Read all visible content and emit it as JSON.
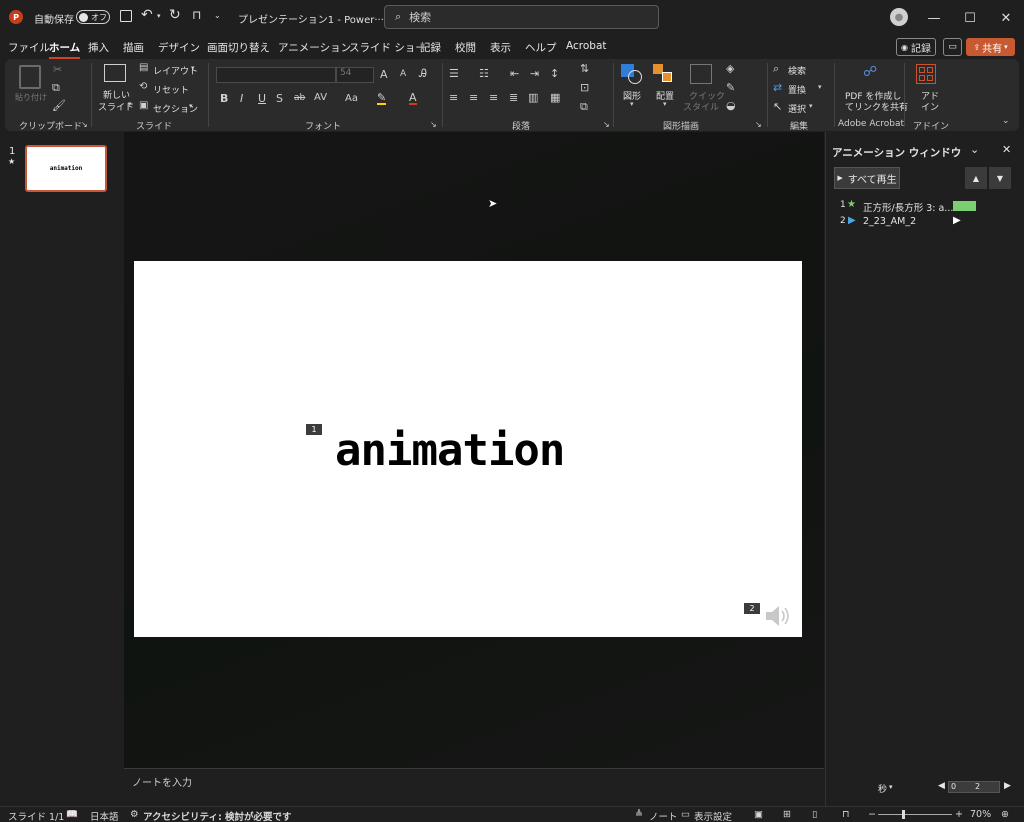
{
  "titlebar": {
    "autosave_label": "自動保存",
    "autosave_state": "オフ",
    "doc_title": "プレゼンテーション1 - Power···",
    "search_placeholder": "検索"
  },
  "menu": {
    "tabs": [
      "ファイル",
      "ホーム",
      "挿入",
      "描画",
      "デザイン",
      "画面切り替え",
      "アニメーション",
      "スライド ショー",
      "記録",
      "校閲",
      "表示",
      "ヘルプ",
      "Acrobat"
    ],
    "active": "ホーム",
    "record_label": "記録",
    "share_label": "共有"
  },
  "ribbon": {
    "clipboard": {
      "paste": "貼り付け",
      "group": "クリップボード"
    },
    "slides": {
      "new_slide_1": "新しい",
      "new_slide_2": "スライド",
      "layout": "レイアウト",
      "reset": "リセット",
      "section": "セクション",
      "group": "スライド"
    },
    "font": {
      "size": "54",
      "bold": "B",
      "italic": "I",
      "underline": "U",
      "shadow": "S",
      "strike": "ab",
      "spacing": "AV",
      "case": "Aa",
      "color_a": "A",
      "grow": "A",
      "shrink": "A",
      "group": "フォント"
    },
    "paragraph": {
      "group": "段落"
    },
    "drawing": {
      "shapes": "図形",
      "arrange": "配置",
      "quick_style_1": "クイック",
      "quick_style_2": "スタイル",
      "group": "図形描画"
    },
    "editing": {
      "find": "検索",
      "replace": "置換",
      "select": "選択",
      "group": "編集"
    },
    "acrobat": {
      "line1": "PDF を作成し",
      "line2": "てリンクを共有",
      "group": "Adobe Acrobat"
    },
    "addin": {
      "line1": "アド",
      "line2": "イン",
      "group": "アドイン"
    }
  },
  "thumbnails": {
    "number": "1",
    "star": "★",
    "text": "animation"
  },
  "slide": {
    "title_text": "animation",
    "tag1": "1",
    "tag2": "2"
  },
  "notes": {
    "placeholder": "ノートを入力"
  },
  "animation_pane": {
    "title": "アニメーション ウィンドウ",
    "play_all": "すべて再生",
    "items": [
      {
        "index": "1",
        "name": "正方形/長方形 3: a...",
        "bar_color": "#7ccf70"
      },
      {
        "index": "2",
        "name": "2_23_AM_2"
      }
    ],
    "seconds_label": "秒",
    "timeline_start": "0",
    "timeline_mark": "2"
  },
  "status": {
    "slide": "スライド 1/1",
    "language": "日本語",
    "accessibility": "アクセシビリティ: 検討が必要です",
    "notes": "ノート",
    "display_settings": "表示設定",
    "zoom": "70%"
  }
}
